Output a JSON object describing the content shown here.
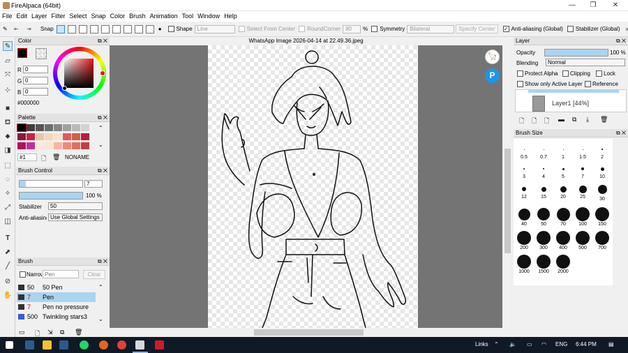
{
  "window": {
    "title": "FireAlpaca (64bit)",
    "minimize": "—",
    "maximize": "❐",
    "close": "✕"
  },
  "menu": [
    "File",
    "Edit",
    "Layer",
    "Filter",
    "Select",
    "Snap",
    "Color",
    "Brush",
    "Animation",
    "Tool",
    "Window",
    "Help"
  ],
  "toolbar": {
    "snap_label": "Snap",
    "shape_label": "Shape",
    "shape_value": "Line",
    "select_from_center": "Select From Center",
    "round_corner": "RoundCorner",
    "round_value": "80",
    "percent": "%",
    "symmetry": "Symmetry",
    "symmetry_value": "Bilateral",
    "specify_center": "Specify Center",
    "antialias_global": "Anti-aliasing (Global)",
    "stabilizer_global": "Stabilizer (Global)",
    "more": "»"
  },
  "color_panel": {
    "title": "Color",
    "r_label": "R",
    "g_label": "G",
    "b_label": "B",
    "r": "0",
    "g": "0",
    "b": "0",
    "hex": "#000000",
    "current": "#000000"
  },
  "palette_panel": {
    "title": "Palette",
    "index": "#1",
    "name": "NONAME",
    "row1": [
      "#000000",
      "#3c3c3c",
      "#555555",
      "#6e6e6e",
      "#878787",
      "#a0a0a0",
      "#b9b9b9",
      "#d2d2d2"
    ],
    "row2": [
      "#8a1a3a",
      "#cc2244",
      "#e8c6a6",
      "#f2d7b9",
      "#f7e3cb",
      "#e05a5a",
      "#d06040",
      "#b02040"
    ],
    "row3": [
      "#b01060",
      "#c030a0",
      "#fbe9d9",
      "#fde5d0",
      "#f6b5a0",
      "#ee8877",
      "#e07060",
      "#c04040"
    ]
  },
  "brush_control": {
    "title": "Brush Control",
    "size": "7",
    "opacity": "100 %",
    "opacity_level": 1.0,
    "stabilizer_label": "Stabilizer",
    "stabilizer_value": "50",
    "antialias_label": "Anti-aliasing",
    "antialias_value": "Use Global Settings"
  },
  "brush_panel": {
    "title": "Brush",
    "narrow_label": "Narrow",
    "search_placeholder": "Pen",
    "clear": "Clear",
    "items": [
      {
        "size": "50",
        "name": "50 Pen",
        "color": "#333333"
      },
      {
        "size": "7",
        "name": "Pen",
        "color": "#333333"
      },
      {
        "size": "7",
        "name": "Pen no pressure",
        "color": "#333333"
      },
      {
        "size": "500",
        "name": "Twinkling stars3",
        "color": "#3a5bd8"
      }
    ]
  },
  "canvas": {
    "title": "WhatsApp Image 2026-04-14 at 22.49.36.jpeg"
  },
  "layer_panel": {
    "title": "Layer",
    "opacity_label": "Opacity",
    "opacity_value": "100 %",
    "opacity_level": 1.0,
    "blending_label": "Blending",
    "blending_value": "Normal",
    "protect_alpha": "Protect Alpha",
    "clipping": "Clipping",
    "lock": "Lock",
    "show_active": "Show only Active Layer",
    "reference": "Reference",
    "layer_name": "Layer1 [44%]"
  },
  "brush_size_panel": {
    "title": "Brush Size",
    "sizes": [
      "0.5",
      "0.7",
      "1",
      "1.5",
      "2",
      "3",
      "4",
      "5",
      "7",
      "10",
      "12",
      "15",
      "20",
      "25",
      "30",
      "40",
      "50",
      "70",
      "100",
      "150",
      "200",
      "300",
      "400",
      "500",
      "700",
      "1000",
      "1500",
      "2000"
    ]
  },
  "taskbar": {
    "links": "Links",
    "lang": "ENG",
    "time": "6:44 PM"
  },
  "colors": {
    "accent": "#2e89c9",
    "selection": "#cde6f7",
    "canvas_bg": "#747474",
    "taskbar": "#101a26"
  }
}
